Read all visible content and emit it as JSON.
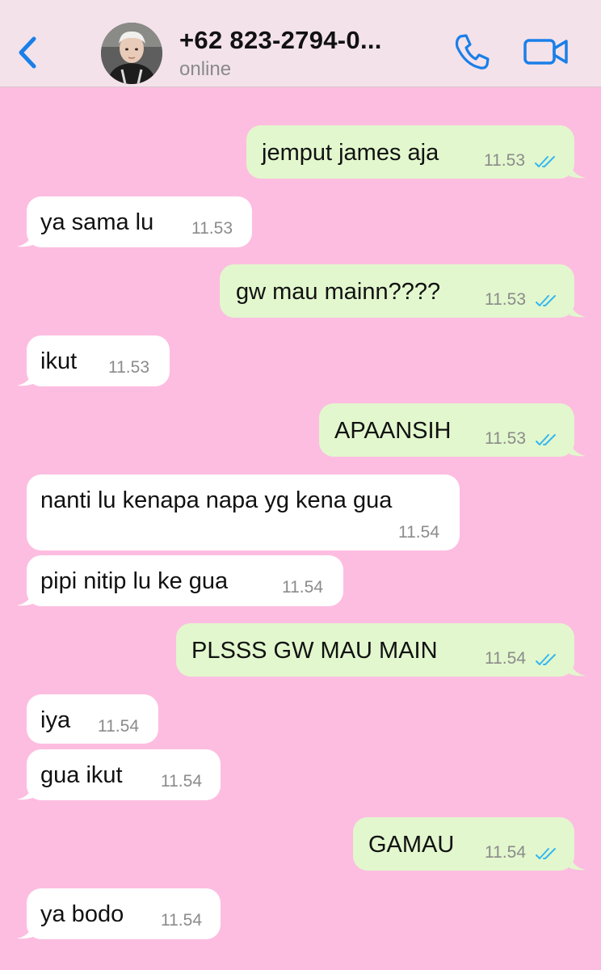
{
  "header": {
    "contact_name": "+62 823-2794-0...",
    "status": "online",
    "icons": {
      "back": "chevron-left-icon",
      "avatar": "contact-avatar",
      "call": "phone-icon",
      "video": "video-camera-icon"
    }
  },
  "colors": {
    "chat_background": "#fdbde0",
    "header_background": "#f3e2ea",
    "incoming_bubble": "#ffffff",
    "outgoing_bubble": "#e2f7cd",
    "accent": "#1a7fe8",
    "read_ticks": "#34b7f1"
  },
  "messages": [
    {
      "direction": "out",
      "text": "jemput james aja",
      "time": "11.53",
      "read": true
    },
    {
      "direction": "in",
      "text": "ya sama lu",
      "time": "11.53"
    },
    {
      "direction": "out",
      "text": "gw mau mainn????",
      "time": "11.53",
      "read": true
    },
    {
      "direction": "in",
      "text": "ikut",
      "time": "11.53"
    },
    {
      "direction": "out",
      "text": "APAANSIH",
      "time": "11.53",
      "read": true
    },
    {
      "direction": "in",
      "text": "nanti lu kenapa napa yg kena gua",
      "time": "11.54"
    },
    {
      "direction": "in",
      "text": "pipi nitip lu ke gua",
      "time": "11.54"
    },
    {
      "direction": "out",
      "text": "PLSSS GW MAU MAIN",
      "time": "11.54",
      "read": true
    },
    {
      "direction": "in",
      "text": "iya",
      "time": "11.54"
    },
    {
      "direction": "in",
      "text": "gua ikut",
      "time": "11.54"
    },
    {
      "direction": "out",
      "text": "GAMAU",
      "time": "11.54",
      "read": true
    },
    {
      "direction": "in",
      "text": "ya bodo",
      "time": "11.54"
    }
  ]
}
